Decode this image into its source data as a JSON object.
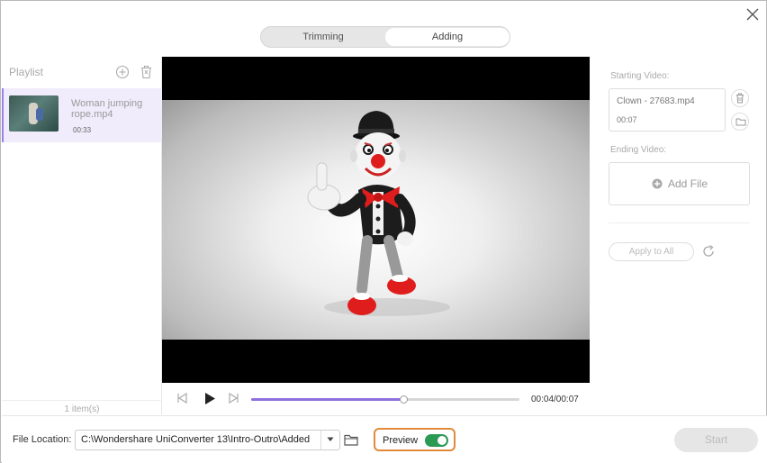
{
  "tabs": [
    {
      "label": "Trimming",
      "active": false
    },
    {
      "label": "Adding",
      "active": true
    }
  ],
  "playlist": {
    "title": "Playlist",
    "items": [
      {
        "name": "Woman jumping rope.mp4",
        "duration": "00:33"
      }
    ],
    "count_label": "1 item(s)"
  },
  "player": {
    "time_label": "00:04/00:07",
    "progress": 0.57
  },
  "right_panel": {
    "starting_label": "Starting Video:",
    "starting_file": "Clown - 27683.mp4",
    "starting_duration": "00:07",
    "ending_label": "Ending Video:",
    "add_file_label": "Add File",
    "apply_label": "Apply to All"
  },
  "bottom": {
    "file_location_label": "File Location:",
    "file_location_value": "C:\\Wondershare UniConverter 13\\Intro-Outro\\Added",
    "preview_label": "Preview",
    "preview_on": true,
    "start_label": "Start"
  },
  "colors": {
    "accent": "#8f70de",
    "toggle_on": "#2a9a55",
    "highlight_border": "#e08a3a"
  }
}
